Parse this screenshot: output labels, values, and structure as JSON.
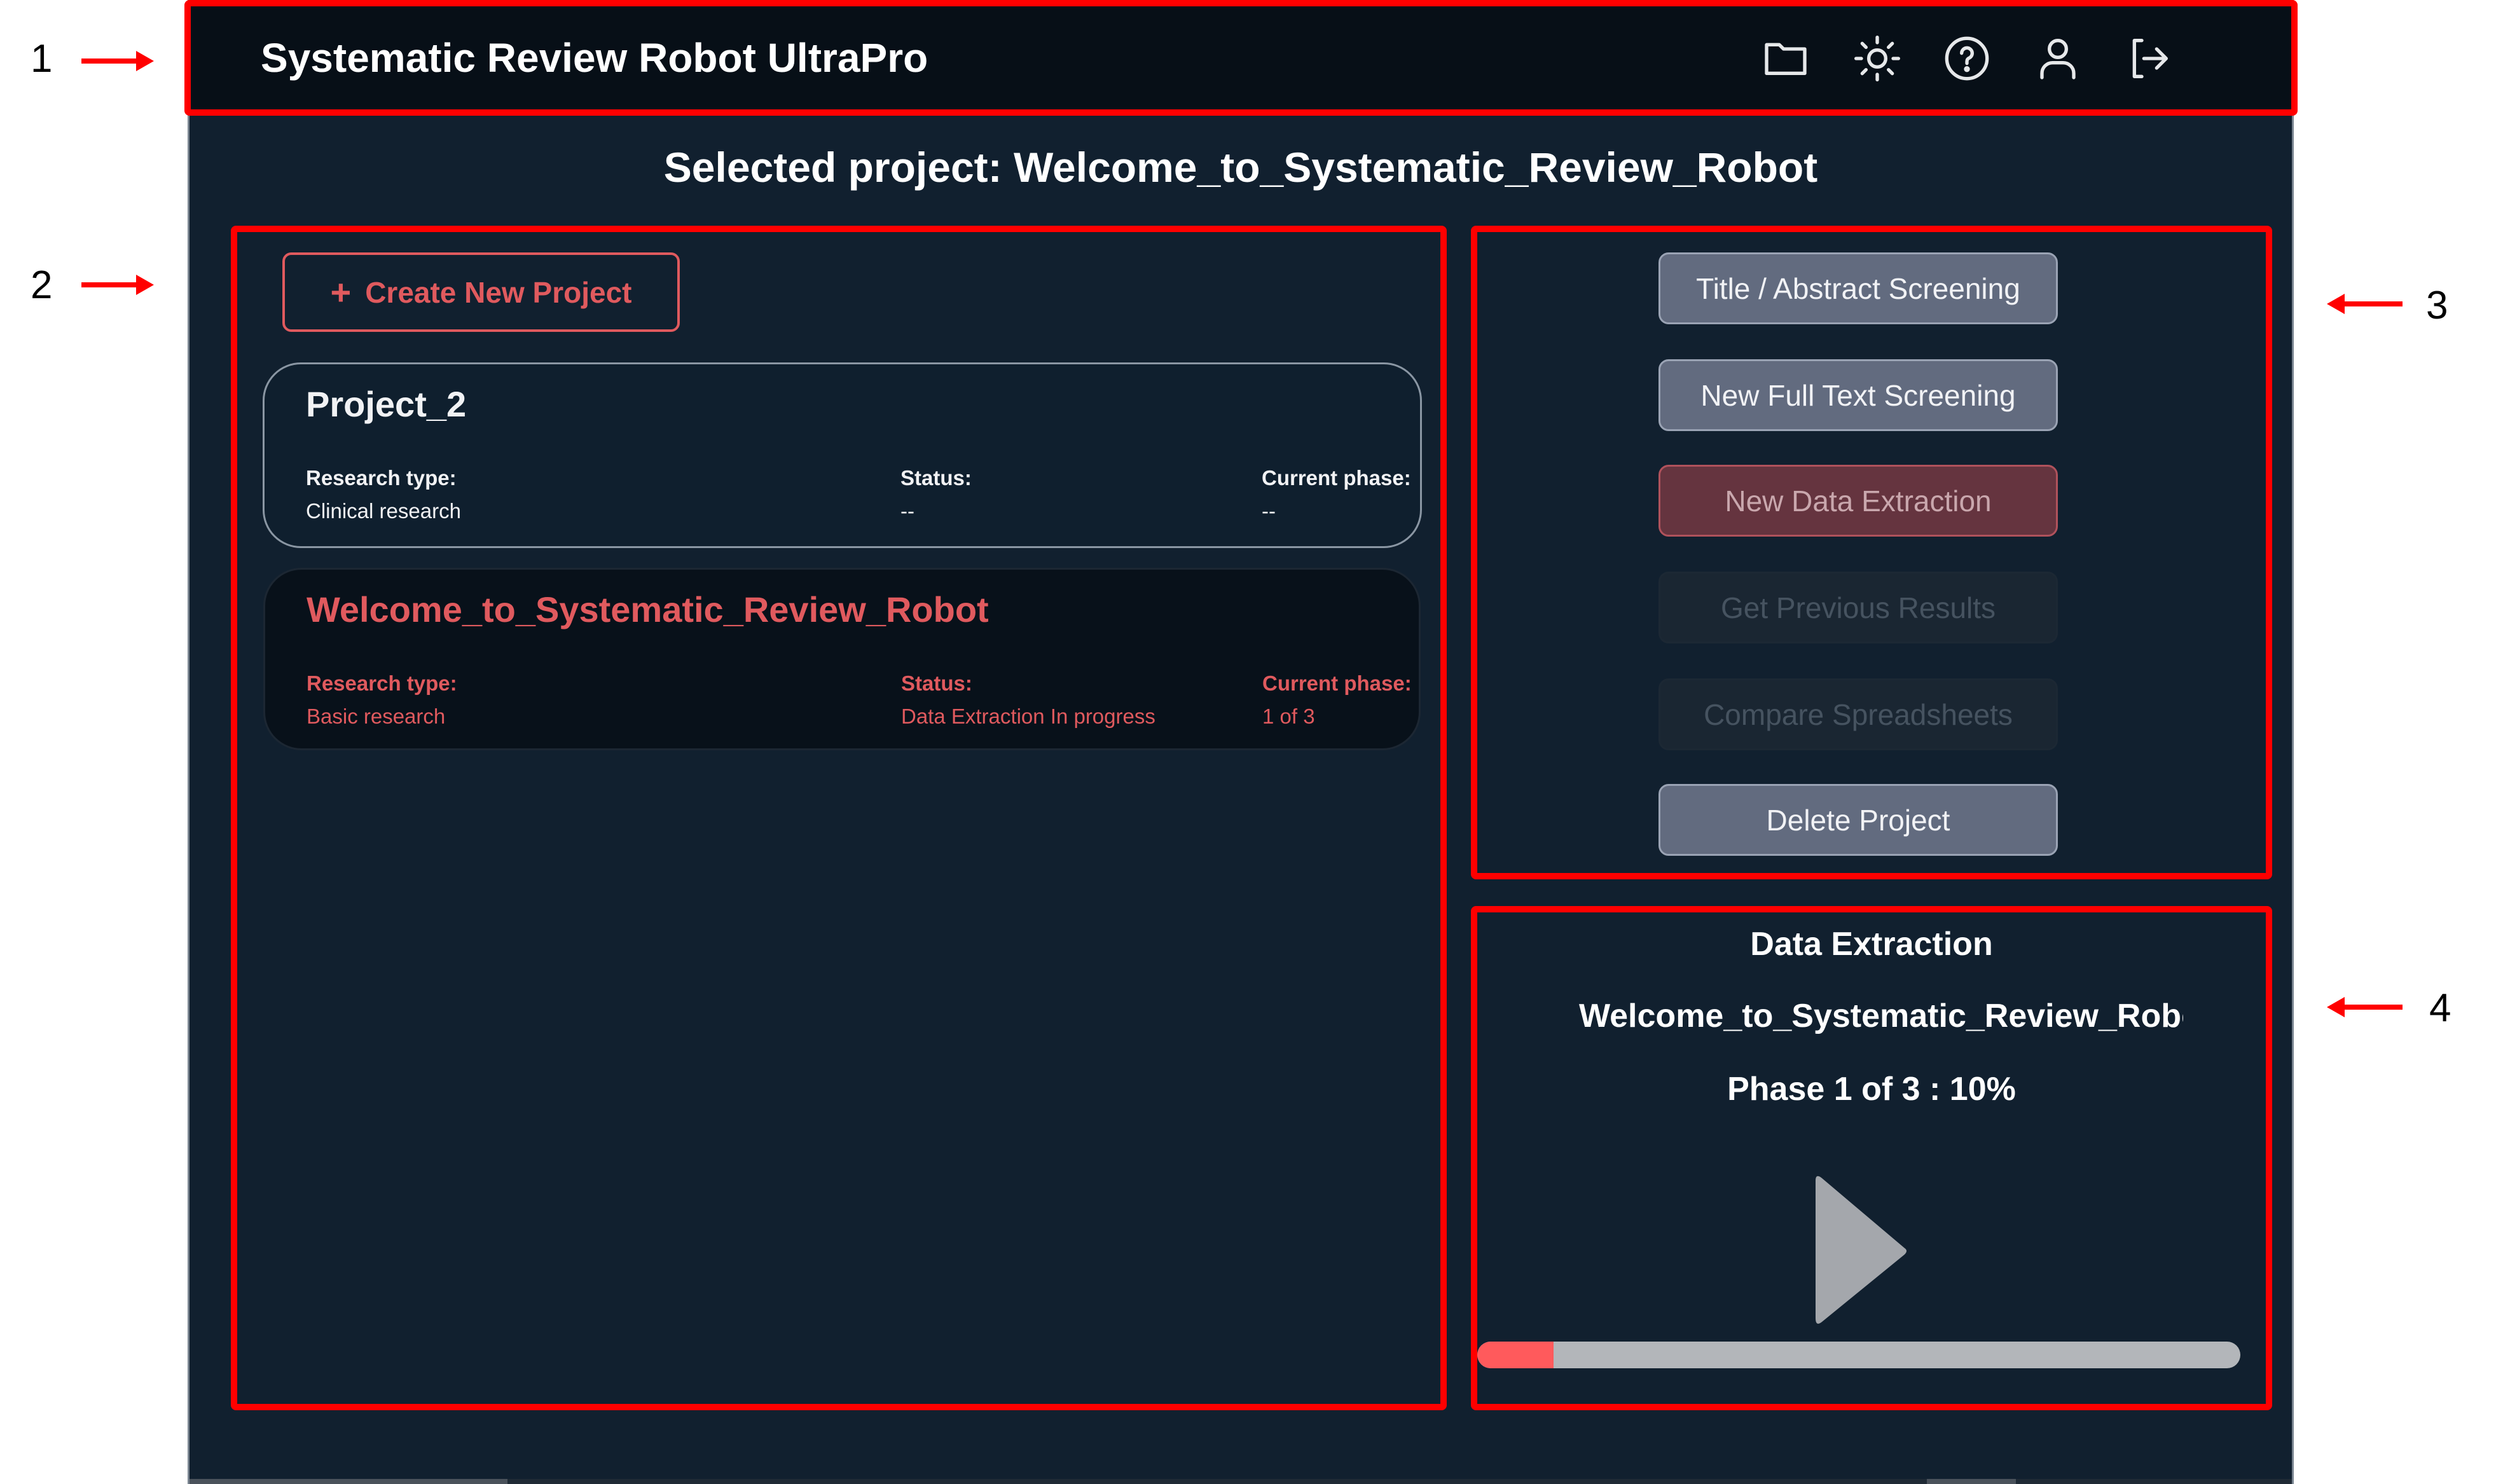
{
  "annotations": [
    "1",
    "2",
    "3",
    "4"
  ],
  "header": {
    "title": "Systematic Review Robot UltraPro",
    "icons": [
      "folder-icon",
      "sun-icon",
      "help-icon",
      "user-icon",
      "logout-icon"
    ]
  },
  "selected_project": {
    "label": "Selected project: Welcome_to_Systematic_Review_Robot"
  },
  "projects_panel": {
    "create_button": {
      "icon": "+",
      "label": "Create New Project"
    },
    "projects": [
      {
        "name": "Project_2",
        "selected": false,
        "fields": [
          {
            "label": "Research type:",
            "value": "Clinical research"
          },
          {
            "label": "Status:",
            "value": "--"
          },
          {
            "label": "Current phase:",
            "value": "--"
          }
        ]
      },
      {
        "name": "Welcome_to_Systematic_Review_Robot",
        "selected": true,
        "fields": [
          {
            "label": "Research type:",
            "value": "Basic research"
          },
          {
            "label": "Status:",
            "value": "Data Extraction In progress"
          },
          {
            "label": "Current phase:",
            "value": "1 of 3"
          }
        ]
      }
    ]
  },
  "actions_panel": {
    "buttons": [
      {
        "label": "Title / Abstract Screening",
        "state": "enabled"
      },
      {
        "label": "New Full Text Screening",
        "state": "enabled"
      },
      {
        "label": "New Data Extraction",
        "state": "active"
      },
      {
        "label": "Get Previous Results",
        "state": "disabled"
      },
      {
        "label": "Compare Spreadsheets",
        "state": "disabled"
      },
      {
        "label": "Delete Project",
        "state": "enabled"
      }
    ]
  },
  "progress_panel": {
    "title": "Data Extraction",
    "project_name": "Welcome_to_Systematic_Review_Robot",
    "phase_text": "Phase 1 of 3 : 10%",
    "progress_percent": 10,
    "play_icon": "play-icon"
  },
  "colors": {
    "accent": "#e05a5e",
    "progress_fill": "#ff5a5c",
    "progress_track": "#b3b6ba",
    "background": "#11202f",
    "header": "#070f17",
    "annotation": "#ff0000"
  }
}
